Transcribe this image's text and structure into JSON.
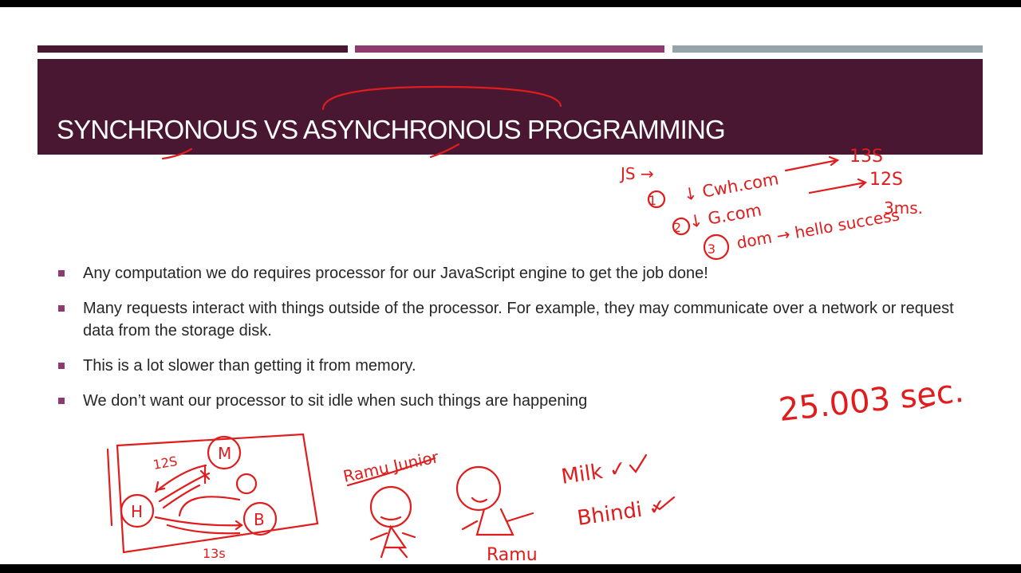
{
  "slide": {
    "title": "SYNCHRONOUS VS ASYNCHRONOUS PROGRAMMING",
    "bullets": [
      "Any computation we do requires processor for our JavaScript engine to get the job done!",
      "Many requests interact with things outside of the processor. For example, they may communicate over a network or request data from the storage disk.",
      "This is a lot slower than getting it from memory.",
      "We don’t want our processor to sit idle when such things are happening"
    ]
  },
  "annotations": {
    "ink_color": "#e01c1c",
    "js_label": "JS →",
    "list": [
      {
        "num": "1",
        "text": "↓ Cwh.com",
        "result": "13S"
      },
      {
        "num": "2",
        "text": "↓ G.com",
        "result": "12S"
      },
      {
        "num": "3",
        "text": "dom → hello success",
        "result": "3ms."
      }
    ],
    "total": "25.003 sec.",
    "diagram_labels": {
      "h": "H",
      "m": "M",
      "b": "B",
      "top_time": "12S",
      "bottom_time": "13s"
    },
    "ramu_junior": "Ramu Junior",
    "ramu": "Ramu",
    "milk": "Milk ✓",
    "bhindi": "Bhindi ✓"
  },
  "colors": {
    "title_band": "#4a1733",
    "bar_mid": "#8f3a6f",
    "bar_grey": "#97a3aa",
    "bullet_marker": "#8f3a6f"
  }
}
